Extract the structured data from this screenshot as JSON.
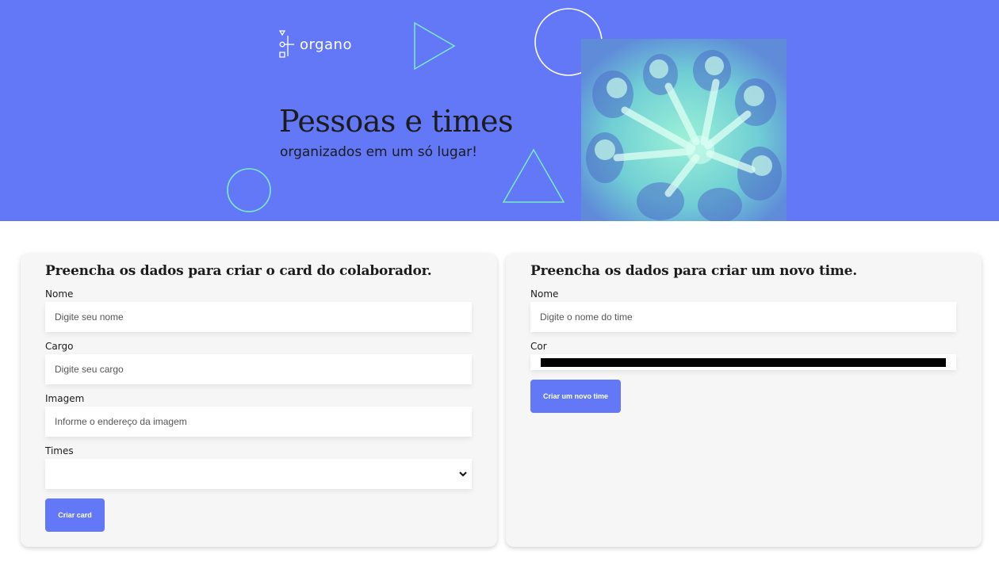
{
  "banner": {
    "logo_text": "organo",
    "headline": "Pessoas e times",
    "subheadline": "organizados em um só lugar!",
    "color": "#6278F7",
    "photo_icon": "team-hands-together-photo"
  },
  "collaborator_form": {
    "title": "Preencha os dados para criar o card do colaborador.",
    "name_label": "Nome",
    "name_placeholder": "Digite seu nome",
    "role_label": "Cargo",
    "role_placeholder": "Digite seu cargo",
    "image_label": "Imagem",
    "image_placeholder": "Informe o endereço da imagem",
    "teams_label": "Times",
    "teams_selected": "",
    "submit_label": "Criar card"
  },
  "team_form": {
    "title": "Preencha os dados para criar um novo time.",
    "name_label": "Nome",
    "name_placeholder": "Digite o nome do time",
    "color_label": "Cor",
    "color_value": "#000000",
    "submit_label": "Criar um novo time"
  },
  "colors": {
    "accent": "#6278F7",
    "decoration": "#ffffff",
    "decoration_teal": "#7BEBC4",
    "panel_bg": "#F6F6F6"
  }
}
